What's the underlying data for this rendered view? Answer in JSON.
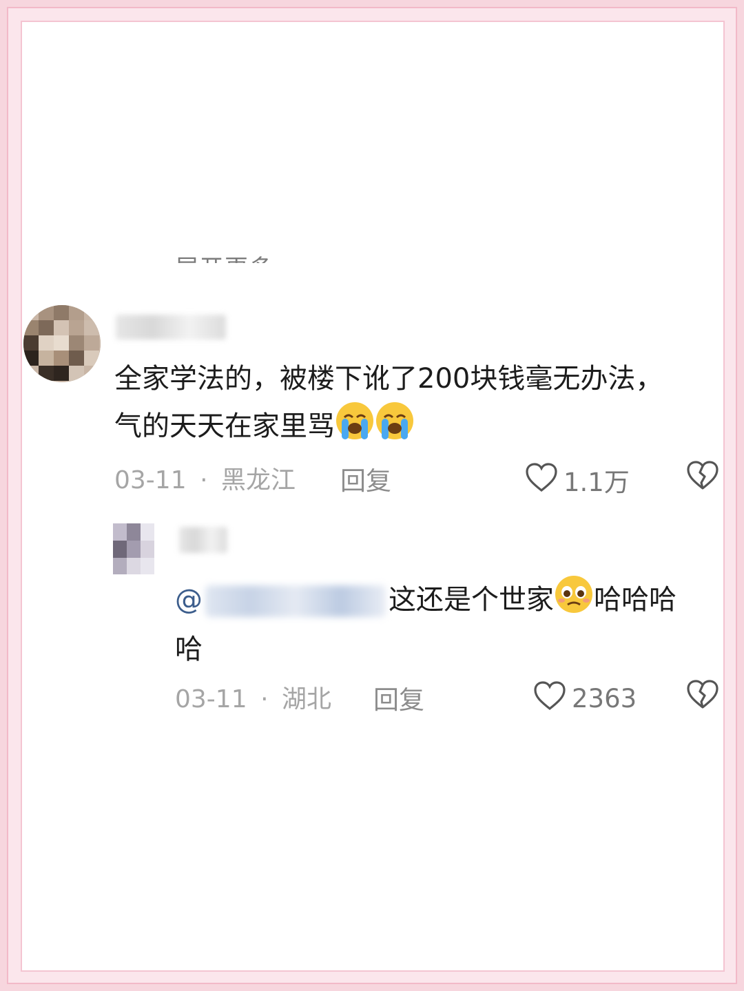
{
  "thread": {
    "truncated_link": "展开更多",
    "comment": {
      "text": "全家学法的，被楼下讹了200块钱毫无办法，气的天天在家里骂",
      "line1": "全家学法的，被楼下讹了200块钱毫无办法，",
      "line2": "气的天天在家里骂",
      "emojis": [
        "loudly-crying-icon",
        "loudly-crying-icon"
      ],
      "date": "03-11",
      "separator": "·",
      "location": "黑龙江",
      "reply_label": "回复",
      "likes": "1.1万"
    },
    "reply": {
      "mention_prefix": "@",
      "text": "这还是个世家",
      "text_after": "哈哈哈",
      "line2": "哈",
      "emoji": "pleading-face-icon",
      "date": "03-11",
      "separator": "·",
      "location": "湖北",
      "reply_label": "回复",
      "likes": "2363"
    }
  },
  "colors": {
    "frame_pink": "#f7d6de",
    "text_primary": "#1c1c1c",
    "meta_gray": "#a5a5a5",
    "mention_blue": "#3c5d8c"
  }
}
